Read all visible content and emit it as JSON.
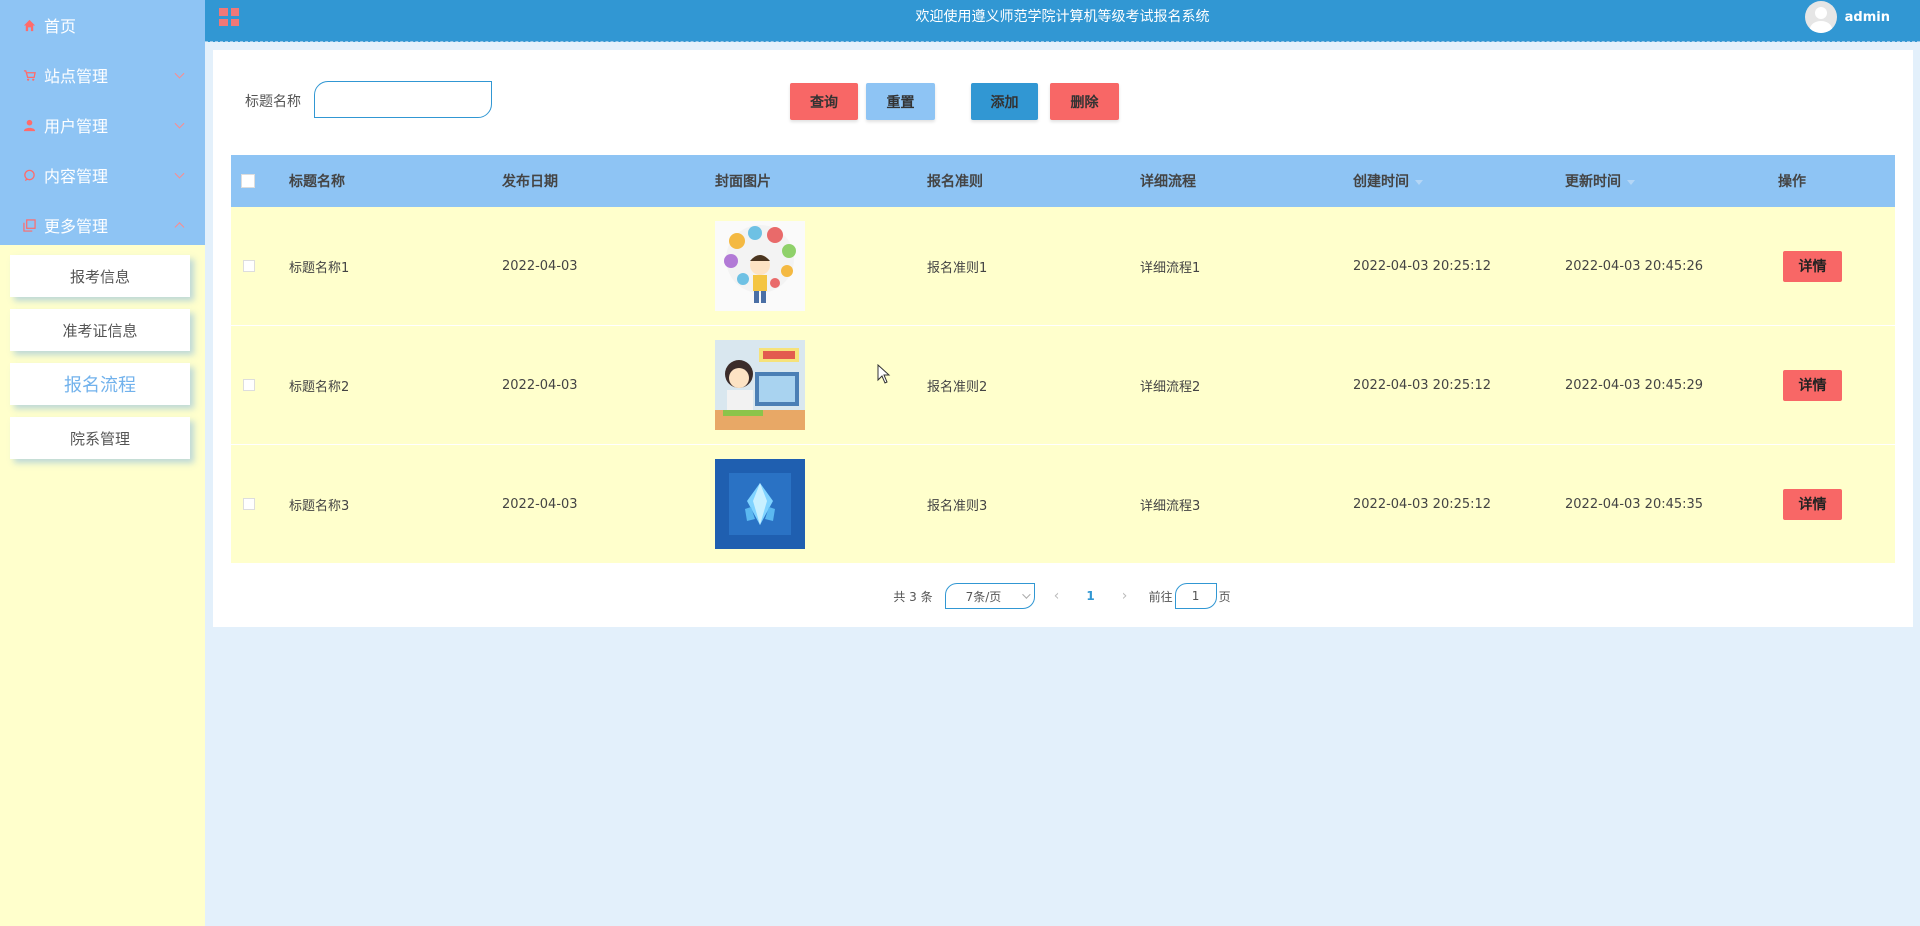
{
  "header": {
    "title": "欢迎使用遵义师范学院计算机等级考试报名系统",
    "username": "admin"
  },
  "sidebar": {
    "items": [
      {
        "label": "首页",
        "icon": "home-icon"
      },
      {
        "label": "站点管理",
        "icon": "cart-icon"
      },
      {
        "label": "用户管理",
        "icon": "user-icon"
      },
      {
        "label": "内容管理",
        "icon": "chat-icon"
      },
      {
        "label": "更多管理",
        "icon": "copy-icon"
      }
    ],
    "submenu": [
      {
        "label": "报考信息"
      },
      {
        "label": "准考证信息"
      },
      {
        "label": "报名流程",
        "active": true
      },
      {
        "label": "院系管理"
      }
    ]
  },
  "search": {
    "label": "标题名称",
    "value": "",
    "placeholder": ""
  },
  "toolbar": {
    "query_label": "查询",
    "reset_label": "重置",
    "add_label": "添加",
    "delete_label": "删除"
  },
  "table": {
    "columns": [
      "标题名称",
      "发布日期",
      "封面图片",
      "报名准则",
      "详细流程",
      "创建时间",
      "更新时间",
      "操作"
    ],
    "rows": [
      {
        "title": "标题名称1",
        "date": "2022-04-03",
        "image": "cartoon-boy-thinking",
        "rule": "报名准则1",
        "process": "详细流程1",
        "created": "2022-04-03 20:25:12",
        "updated": "2022-04-03 20:45:26",
        "action": "详情"
      },
      {
        "title": "标题名称2",
        "date": "2022-04-03",
        "image": "cartoon-girl-online-study",
        "rule": "报名准则2",
        "process": "详细流程2",
        "created": "2022-04-03 20:25:12",
        "updated": "2022-04-03 20:45:29",
        "action": "详情"
      },
      {
        "title": "标题名称3",
        "date": "2022-04-03",
        "image": "blue-crystal",
        "rule": "报名准则3",
        "process": "详细流程3",
        "created": "2022-04-03 20:25:12",
        "updated": "2022-04-03 20:45:35",
        "action": "详情"
      }
    ]
  },
  "pagination": {
    "total": "共 3 条",
    "page_size": "7条/页",
    "current": "1",
    "goto_prefix": "前往",
    "goto_value": "1",
    "goto_suffix": "页"
  },
  "colors": {
    "sidebar_menu": "#8ec4f4",
    "sidebar_bg": "#ffffcc",
    "header": "#3197d3",
    "accent_red": "#f86766",
    "row_bg": "#ffffcc",
    "page_bg": "#e3f0fb"
  }
}
